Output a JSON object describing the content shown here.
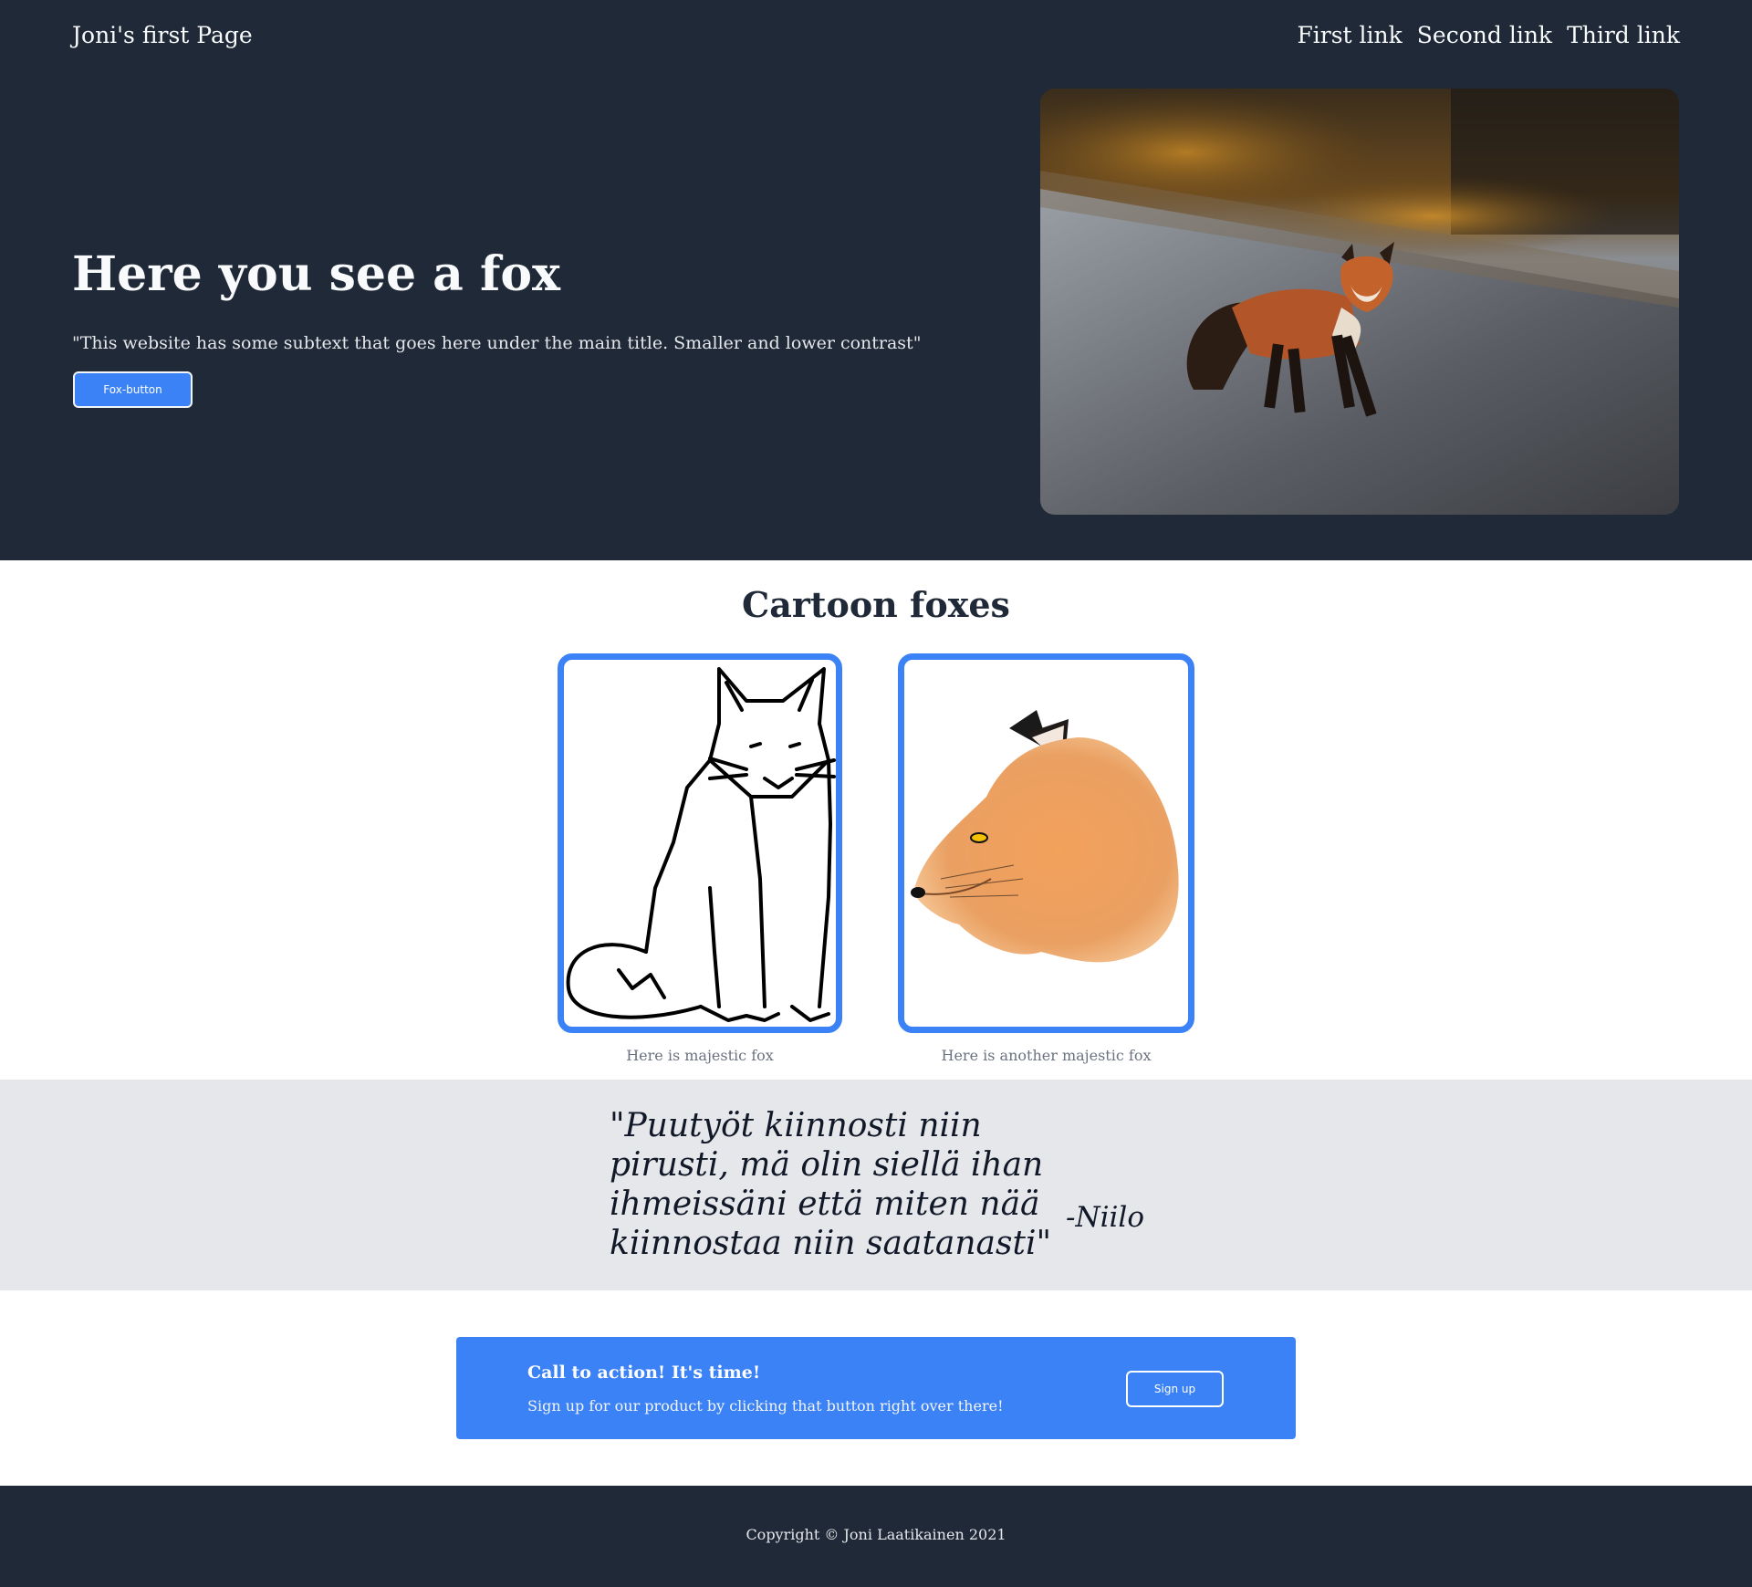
{
  "header": {
    "brand": "Joni's first Page",
    "nav": [
      "First link",
      "Second link",
      "Third link"
    ]
  },
  "hero": {
    "title": "Here you see a fox",
    "subtitle": "\"This website has some subtext that goes here under the main title. Smaller and lower contrast\"",
    "button_label": "Fox-button"
  },
  "gallery": {
    "title": "Cartoon foxes",
    "items": [
      {
        "caption": "Here is majestic fox"
      },
      {
        "caption": "Here is another majestic fox"
      }
    ]
  },
  "quote": {
    "text": "\"Puutyöt kiinnosti niin pirusti, mä olin siellä ihan ihmeissäni että miten nää kiinnostaa niin saatanasti\"",
    "author": "-Niilo"
  },
  "cta": {
    "title": "Call to action! It's time!",
    "subtitle": "Sign up for our product by clicking that button right over there!",
    "button_label": "Sign up"
  },
  "footer": {
    "copyright": "Copyright © Joni Laatikainen 2021"
  },
  "colors": {
    "dark": "#1f2937",
    "accent": "#3b82f6",
    "quote_bg": "#e5e7eb"
  }
}
